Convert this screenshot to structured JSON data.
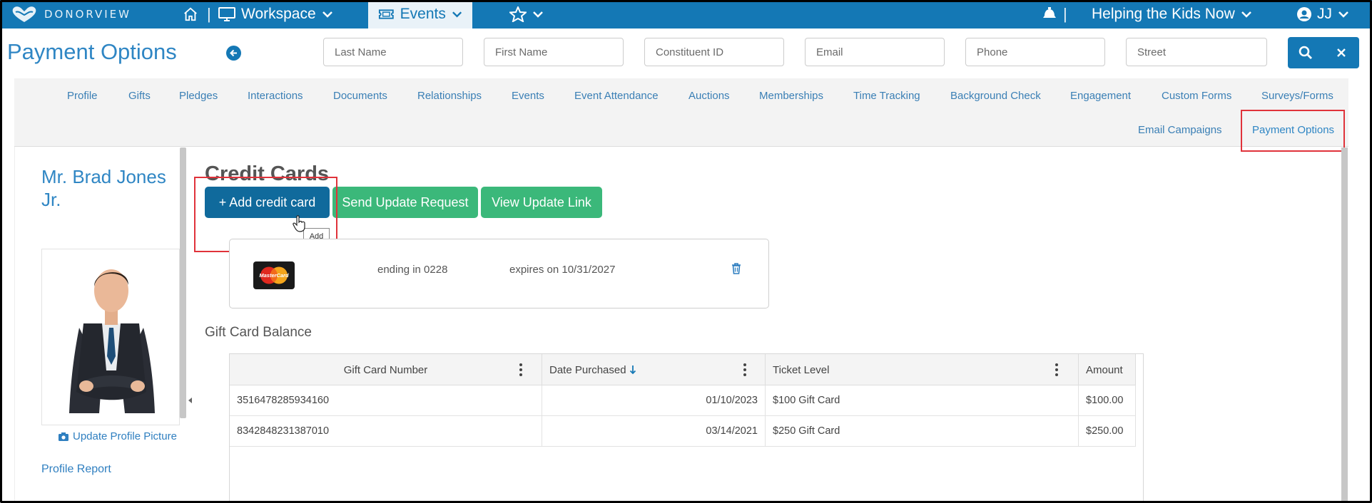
{
  "app": {
    "logo_text": "DONORVIEW"
  },
  "topbar": {
    "workspace_label": "Workspace",
    "events_label": "Events",
    "org_label": "Helping the Kids Now",
    "user_label": "JJ",
    "separator": "|"
  },
  "header": {
    "title": "Payment Options",
    "search": {
      "last_name_placeholder": "Last Name",
      "first_name_placeholder": "First Name",
      "constituent_id_placeholder": "Constituent ID",
      "email_placeholder": "Email",
      "phone_placeholder": "Phone",
      "street_placeholder": "Street"
    }
  },
  "tabs": {
    "row1": [
      "Profile",
      "Gifts",
      "Pledges",
      "Interactions",
      "Documents",
      "Relationships",
      "Events",
      "Event Attendance",
      "Auctions",
      "Memberships",
      "Time Tracking",
      "Background Check",
      "Engagement",
      "Custom Forms",
      "Surveys/Forms"
    ],
    "row2": [
      "Email Campaigns",
      "Payment Options"
    ],
    "active": "Payment Options"
  },
  "profile": {
    "name_line1": "Mr. Brad Jones",
    "name_line2": "Jr.",
    "update_picture_label": "Update Profile Picture",
    "profile_report_label": "Profile Report"
  },
  "credit_cards": {
    "title": "Credit Cards",
    "add_button": "+ Add credit card",
    "send_button": "Send Update Request",
    "view_button": "View Update Link",
    "tooltip": "Add",
    "card": {
      "brand": "MasterCard",
      "ending": "ending in 0228",
      "expires": "expires on 10/31/2027"
    }
  },
  "gift_cards": {
    "title": "Gift Card Balance",
    "columns": [
      "Gift Card Number",
      "Date Purchased",
      "Ticket Level",
      "Amount"
    ],
    "sort_column": "Date Purchased",
    "sort_direction": "descending",
    "rows": [
      {
        "number": "3516478285934160",
        "date": "01/10/2023",
        "level": "$100 Gift Card",
        "amount": "$100.00"
      },
      {
        "number": "8342848231387010",
        "date": "03/14/2021",
        "level": "$250 Gift Card",
        "amount": "$250.00"
      }
    ]
  },
  "colors": {
    "primary": "#1478b5",
    "accent_green": "#3bb87a",
    "highlight_red": "#e0323a"
  }
}
